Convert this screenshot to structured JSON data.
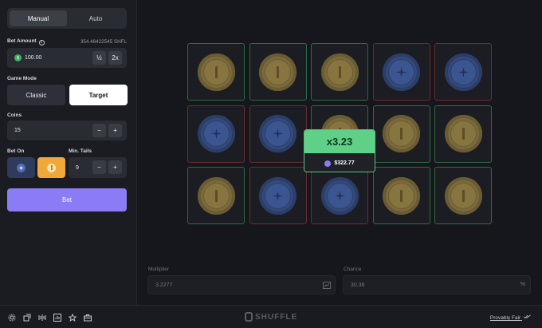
{
  "left_panel": {
    "mode_tabs": [
      {
        "label": "Manual",
        "active": true
      },
      {
        "label": "Auto",
        "active": false
      }
    ],
    "bet_amount": {
      "label": "Bet Amount",
      "balance": "354.48422545 SHFL",
      "value": "100.00",
      "half_label": "½",
      "double_label": "2x"
    },
    "game_mode": {
      "label": "Game Mode",
      "classic_label": "Classic",
      "target_label": "Target",
      "selected": "Target"
    },
    "coins": {
      "label": "Coins",
      "value": "15",
      "minus": "−",
      "plus": "+"
    },
    "bet_on": {
      "label": "Bet On",
      "options": [
        "tails",
        "heads"
      ],
      "selected": "heads"
    },
    "min_tails": {
      "label": "Min. Tails",
      "value": "9",
      "minus": "−",
      "plus": "+"
    },
    "bet_button_label": "Bet"
  },
  "board": {
    "rows": [
      [
        {
          "face": "heads",
          "result": "win"
        },
        {
          "face": "heads",
          "result": "win"
        },
        {
          "face": "heads",
          "result": "win"
        },
        {
          "face": "tails",
          "result": "lose"
        },
        {
          "face": "tails",
          "result": "lose"
        }
      ],
      [
        {
          "face": "tails",
          "result": "lose"
        },
        {
          "face": "tails",
          "result": "lose"
        },
        {
          "face": "heads",
          "result": "win"
        },
        {
          "face": "heads",
          "result": "win"
        },
        {
          "face": "heads",
          "result": "win"
        }
      ],
      [
        {
          "face": "heads",
          "result": "win"
        },
        {
          "face": "tails",
          "result": "lose"
        },
        {
          "face": "tails",
          "result": "lose"
        },
        {
          "face": "heads",
          "result": "win"
        },
        {
          "face": "heads",
          "result": "win"
        }
      ]
    ],
    "result_popup": {
      "multiplier": "x3.23",
      "payout": "$322.77"
    }
  },
  "stats": {
    "multiplier": {
      "label": "Multiplier",
      "value": "3.2277"
    },
    "chance": {
      "label": "Chance",
      "value": "30.36",
      "unit": "%"
    }
  },
  "footer": {
    "brand": "SHUFFLE",
    "provably_fair": "Provably Fair",
    "icons": [
      "gear-icon",
      "popout-icon",
      "stats-icon",
      "chart-icon",
      "star-icon",
      "case-icon"
    ]
  },
  "colors": {
    "accent": "#8b7cf6",
    "win": "#5fd087",
    "heads": "#86753f",
    "tails": "#3b5590",
    "bet_on_heads": "#f0a83a"
  }
}
